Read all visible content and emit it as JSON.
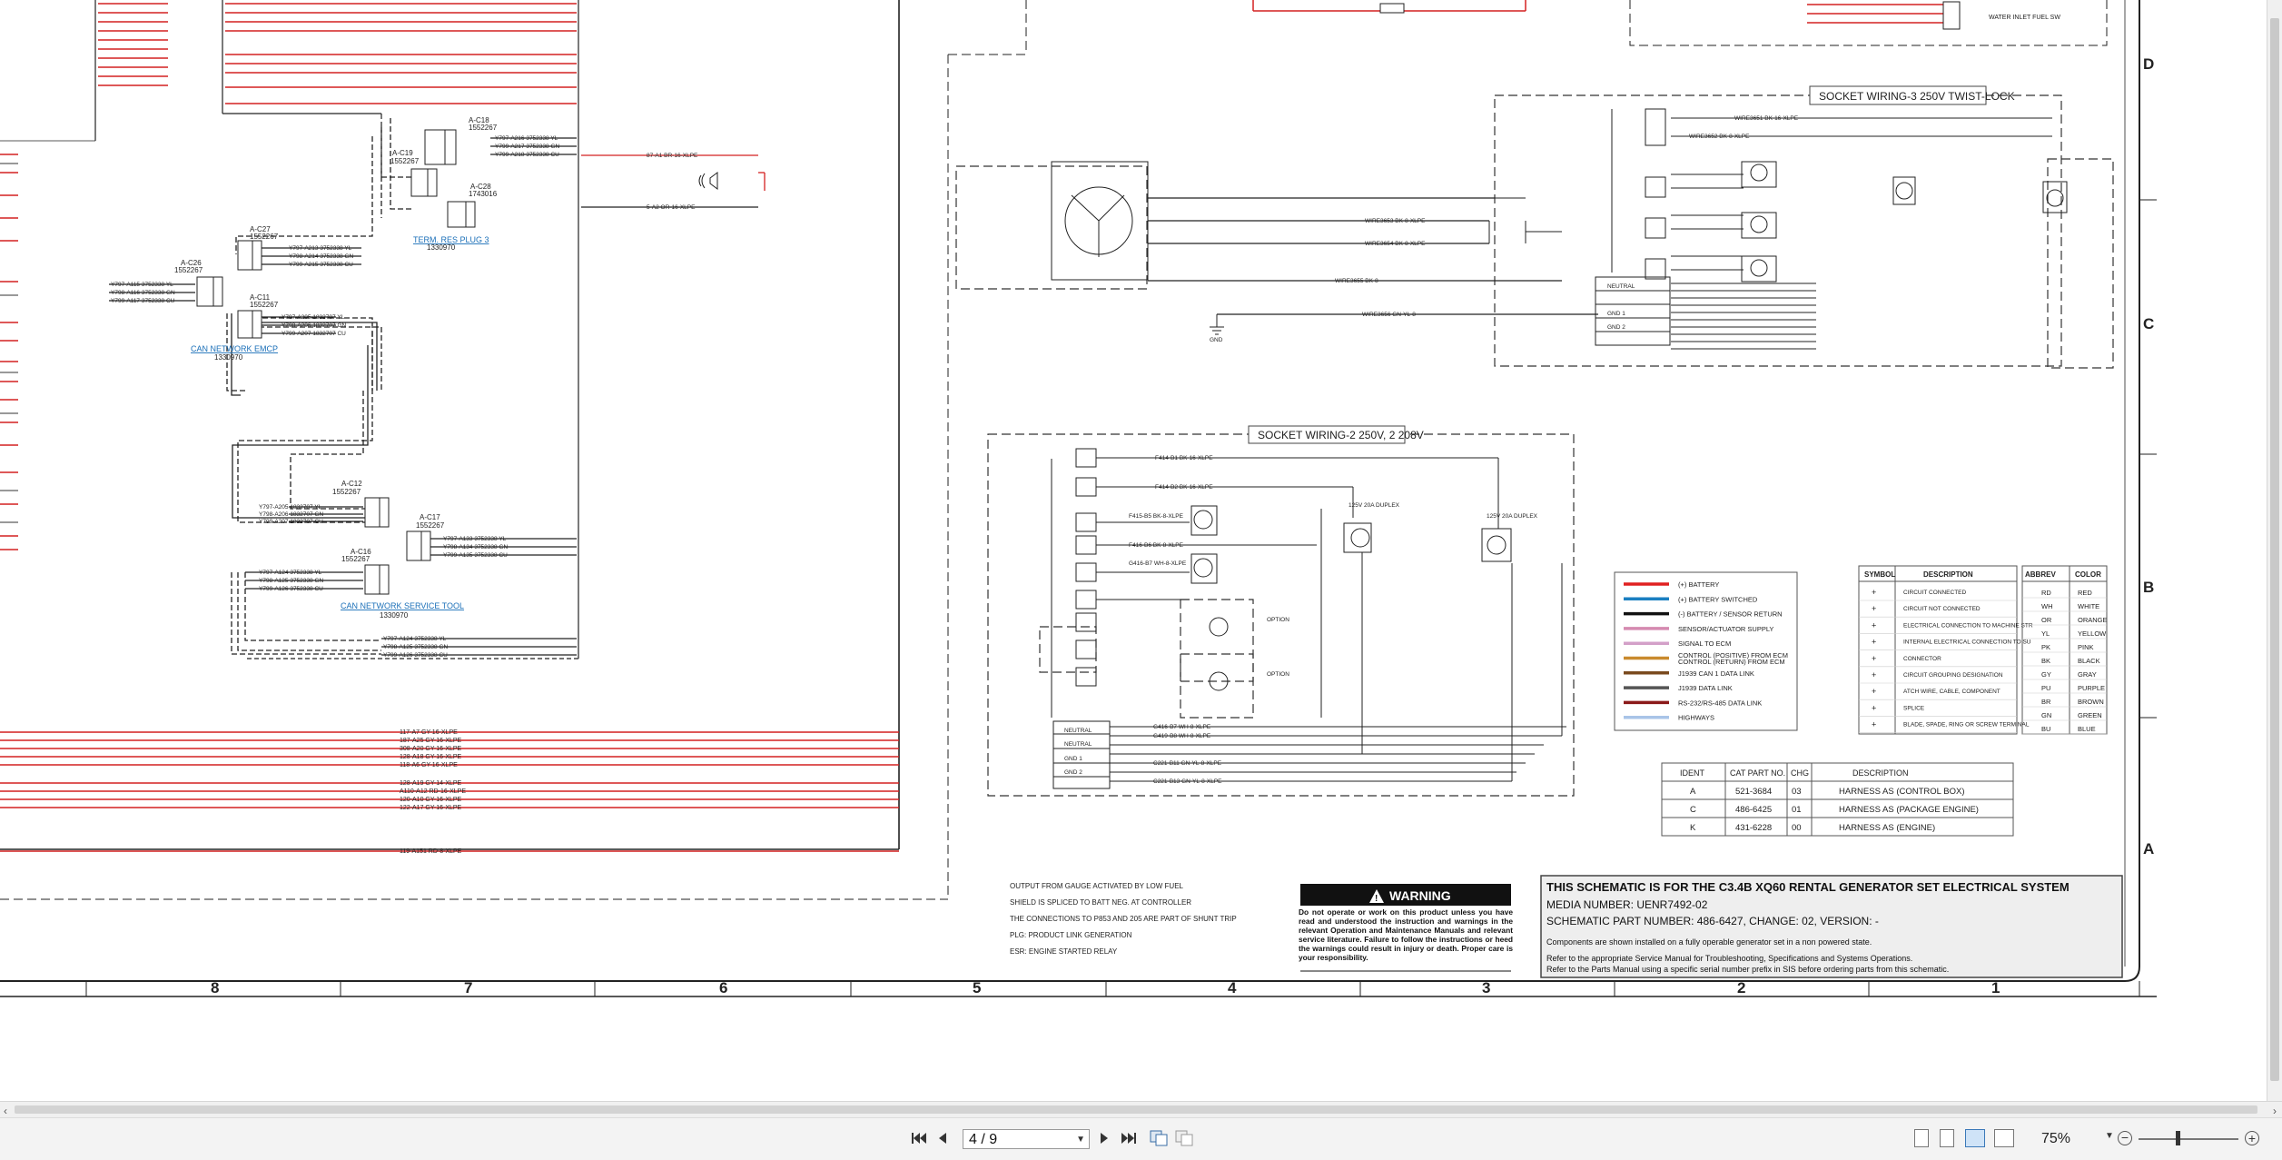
{
  "document": {
    "socket_wiring_3": "SOCKET WIRING-3 250V TWIST-LOCK",
    "socket_wiring_2": "SOCKET WIRING-2 250V, 2 208V",
    "connectors": {
      "a_c27": "A-C27",
      "a_c27_pn": "1552267",
      "a_c26": "A-C26",
      "a_c26_pn": "1552267",
      "a_c11": "A-C11",
      "a_c11_pn": "1552267",
      "a_c19": "A-C19",
      "a_c19_pn": "1552267",
      "a_c18": "A-C18",
      "a_c18_pn": "1552267",
      "a_c28": "A-C28",
      "a_c28_pn": "1743016",
      "a_c12": "A-C12",
      "a_c12_pn": "1552267",
      "a_c16": "A-C16",
      "a_c16_pn": "1552267",
      "a_c17": "A-C17",
      "a_c17_pn": "1552267"
    },
    "links": {
      "term_res_plug": "TERM. RES PLUG 3",
      "term_res_plug_pn": "1330970",
      "can_network_emcp": "CAN NETWORK EMCP",
      "can_network_emcp_pn": "1330970",
      "can_network_service_tool": "CAN NETWORK SERVICE TOOL",
      "can_network_service_tool_pn": "1330970"
    },
    "water_inlet": "WATER INLET FUEL SW",
    "wire_labels": [
      "F414-B1 BK-16-XLPE",
      "F414-B2 BK-16-XLPE",
      "F415-B5 BK-8-XLPE",
      "F416-B6 BK-8-XLPE",
      "G416-B7 WH-8-XLPE",
      "G419-B8 WH-8-XLPE",
      "C221-B11 GN-YL-8-XLPE",
      "C221-B13 GN-YL-8-XLPE",
      "Y797-A216 3752338 YL",
      "Y799-A217 3752338 GN",
      "Y799-A218 3752338 CU",
      "Y797-A213 3752338 YL",
      "Y798-A214 3752338 GN",
      "Y799-A215 3752338 CU",
      "Y797-A115 3752338 YL",
      "Y798-A116 3752338 GN",
      "Y799-A117 3752338 CU",
      "Y797-A205 1832707 YL",
      "Y798-A206 1832707 GN",
      "Y799-A207 1832707 CU",
      "Y797-A133 3752338 YL",
      "Y798-A134 3752338 GN",
      "Y799-A135 3752338 CU",
      "Y797-A124 3752338 YL",
      "Y798-A125 3752338 GN",
      "Y799-A126 3752338 CU",
      "117-A7 GY-16-XLPE",
      "187-A25 GY-16-XLPE",
      "308-A20 GY-16-XLPE",
      "128-A18 GY-16-XLPE",
      "118-A6 GY-16-XLPE",
      "128-A19 GY-14-XLPE",
      "A110-A12 RD-16-XLPE",
      "120-A10 GY-16-XLPE",
      "122-A17 GY-16-XLPE",
      "119-A151 RD-8-XLPE",
      "87-A1 BR-16-XLPE",
      "5-A2 OR-16-XLPE",
      "WIRE3651 BK-16-XLPE",
      "WIRE3652 BK-8-XLPE",
      "WIRE3653 BK-8-XLPE",
      "WIRE3654 BK-8-XLPE",
      "WIRE3655 BK-8",
      "WIRE3656 GN-YL-8"
    ],
    "legend": {
      "items": [
        {
          "label": "(+) BATTERY",
          "color": "#e02020"
        },
        {
          "label": "(+) BATTERY SWITCHED",
          "color": "#1a7fc1"
        },
        {
          "label": "(-) BATTERY / SENSOR RETURN",
          "color": "#111111"
        },
        {
          "label": "SENSOR/ACTUATOR SUPPLY",
          "color": "#d58ab0"
        },
        {
          "label": "SIGNAL TO ECM",
          "color": "#d3a0c8"
        },
        {
          "label": "CONTROL (POSITIVE) FROM ECM\nCONTROL (RETURN) FROM ECM",
          "color": "#c98a2e"
        },
        {
          "label": "J1939 CAN 1 DATA LINK",
          "color": "#7a4a1e"
        },
        {
          "label": "J1939 DATA LINK",
          "color": "#555555"
        },
        {
          "label": "RS-232/RS-485 DATA LINK",
          "color": "#8b1a1a"
        },
        {
          "label": "HIGHWAYS",
          "color": "#a9c4e8"
        }
      ]
    },
    "symbol_table": {
      "headers": [
        "SYMBOL",
        "DESCRIPTION"
      ],
      "rows": [
        "CIRCUIT CONNECTED",
        "CIRCUIT NOT CONNECTED",
        "ELECTRICAL CONNECTION TO MACHINE STRUCTURE",
        "INTERNAL ELECTRICAL CONNECTION TO SURFACE OF COMPONENT",
        "CONNECTOR",
        "CIRCUIT GROUPING DESIGNATION",
        "ATCH WIRE, CABLE, COMPONENT",
        "SPLICE",
        "BLADE, SPADE, RING OR SCREW TERMINAL"
      ]
    },
    "color_table": {
      "headers": [
        "ABBREV",
        "COLOR"
      ],
      "rows": [
        [
          "RD",
          "RED"
        ],
        [
          "WH",
          "WHITE"
        ],
        [
          "OR",
          "ORANGE"
        ],
        [
          "YL",
          "YELLOW"
        ],
        [
          "PK",
          "PINK"
        ],
        [
          "BK",
          "BLACK"
        ],
        [
          "GY",
          "GRAY"
        ],
        [
          "PU",
          "PURPLE"
        ],
        [
          "BR",
          "BROWN"
        ],
        [
          "GN",
          "GREEN"
        ],
        [
          "BU",
          "BLUE"
        ]
      ]
    },
    "ident_table": {
      "headers": [
        "IDENT",
        "CAT PART NO.",
        "CHG",
        "DESCRIPTION"
      ],
      "rows": [
        [
          "A",
          "521-3684",
          "03",
          "HARNESS AS (CONTROL BOX)"
        ],
        [
          "C",
          "486-6425",
          "01",
          "HARNESS AS (PACKAGE ENGINE)"
        ],
        [
          "K",
          "431-6228",
          "00",
          "HARNESS AS (ENGINE)"
        ]
      ]
    },
    "notes": [
      "OUTPUT FROM GAUGE ACTIVATED BY LOW FUEL",
      "SHIELD IS SPLICED TO BATT NEG. AT CONTROLLER",
      "THE CONNECTIONS TO P853 AND 205 ARE PART OF SHUNT TRIP",
      "PLG: PRODUCT LINK GENERATION",
      "ESR: ENGINE STARTED RELAY"
    ],
    "warning": {
      "title": "WARNING",
      "text": "Do not operate or work on this product unless you have read and understood the instruction and warnings in the relevant Operation and Maintenance Manuals and relevant service literature. Failure to follow the instructions or heed the warnings could result in injury or death. Proper care is your responsibility."
    },
    "title_block": {
      "heading": "THIS SCHEMATIC IS FOR THE C3.4B XQ60 RENTAL GENERATOR SET ELECTRICAL SYSTEM",
      "media": "MEDIA NUMBER: UENR7492-02",
      "part": "SCHEMATIC PART NUMBER: 486-6427, CHANGE: 02, VERSION: -",
      "line1": "Components are shown installed on a fully operable generator set in a non powered state.",
      "line2": "Refer to the appropriate Service Manual for Troubleshooting, Specifications and Systems Operations.",
      "line3": "Refer to the Parts Manual using a specific serial number prefix in SIS before ordering parts from this schematic."
    },
    "zone_columns": [
      "8",
      "7",
      "6",
      "5",
      "4",
      "3",
      "2",
      "1"
    ],
    "zone_rows": [
      "D",
      "C",
      "B",
      "A"
    ],
    "option_labels": [
      "OPTION",
      "OPTION"
    ],
    "misc": {
      "gnd": "GND",
      "neutral": "NEUTRAL",
      "gnd1": "GND 1",
      "gnd2": "GND 2",
      "duplex": "125V 20A DUPLEX"
    }
  },
  "toolbar": {
    "page_indicator": "4 / 9",
    "zoom": "75%"
  }
}
